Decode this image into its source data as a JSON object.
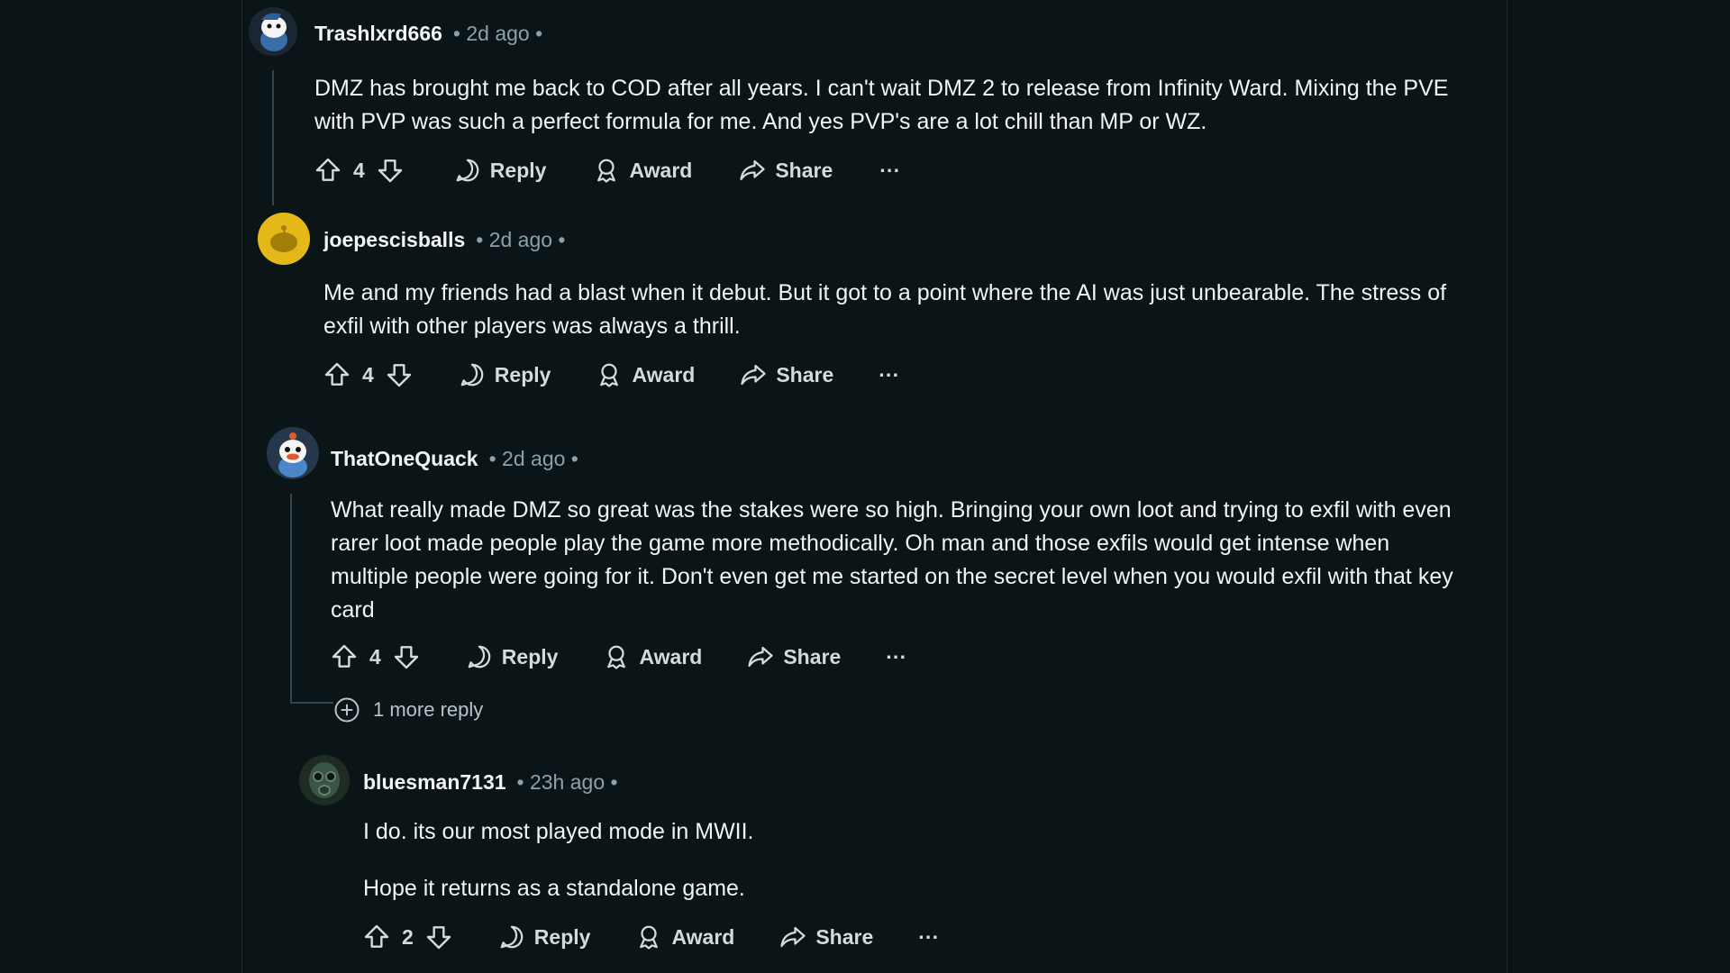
{
  "comments": [
    {
      "username": "Trashlxrd666",
      "time": "• 2d ago •",
      "body": [
        "DMZ has brought me back to COD after all years. I can't wait DMZ 2 to release from Infinity Ward. Mixing the PVE with PVP was such a perfect formula for me. And yes PVP's are a lot chill than MP or WZ."
      ],
      "votes": "4",
      "avatar_icon": "snoo-blue-avatar-icon"
    },
    {
      "username": "joepescisballs",
      "time": "• 2d ago •",
      "body": [
        "Me and my friends had a blast when it debut. But it got to a point where the AI was just unbearable. The stress of exfil with other players was always a thrill."
      ],
      "votes": "4",
      "avatar_icon": "snoo-yellow-avatar-icon"
    },
    {
      "username": "ThatOneQuack",
      "time": "• 2d ago •",
      "body": [
        "What really made DMZ so great was the stakes were so high. Bringing your own loot and trying to exfil with even rarer loot made people play the game more methodically. Oh man and those exfils would get intense when multiple people were going for it. Don't even get me started on the secret level when you would exfil with that key card"
      ],
      "votes": "4",
      "avatar_icon": "snoo-duck-avatar-icon"
    },
    {
      "username": "bluesman7131",
      "time": "• 23h ago •",
      "body": [
        "I do. its our most played mode in MWII.",
        "Hope it returns as a standalone game."
      ],
      "votes": "2",
      "avatar_icon": "gas-mask-avatar-icon"
    }
  ],
  "labels": {
    "reply": "Reply",
    "award": "Award",
    "share": "Share",
    "more": "···"
  },
  "more_replies": "1 more reply",
  "colors": {
    "background": "#0b1416",
    "text": "#f2f4f5",
    "meta": "#8ba2ad",
    "thread": "#33464c"
  }
}
